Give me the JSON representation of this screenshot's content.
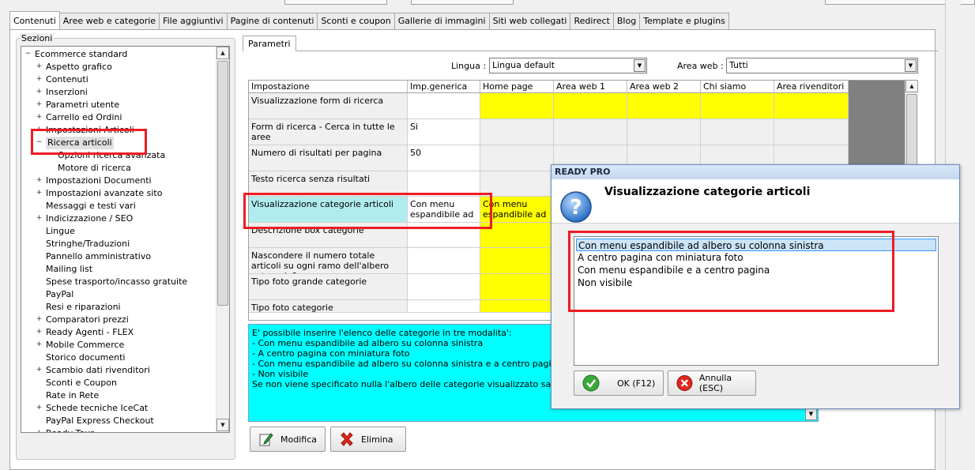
{
  "main_tabs": [
    "Contenuti",
    "Aree web e categorie",
    "File aggiuntivi",
    "Pagine di contenuti",
    "Sconti e coupon",
    "Gallerie di immagini",
    "Siti web collegati",
    "Redirect",
    "Blog",
    "Template e plugins"
  ],
  "sections_title": "Sezioni",
  "tree": {
    "root": "Ecommerce standard",
    "items": [
      {
        "label": "Aspetto grafico",
        "exp": "+"
      },
      {
        "label": "Contenuti",
        "exp": "+"
      },
      {
        "label": "Inserzioni",
        "exp": "+"
      },
      {
        "label": "Parametri utente",
        "exp": "+"
      },
      {
        "label": "Carrello ed Ordini",
        "exp": "+"
      },
      {
        "label": "Impostazioni Articoli",
        "exp": "+"
      },
      {
        "label": "Ricerca articoli",
        "exp": "-"
      },
      {
        "label": "Opzioni ricerca avanzata",
        "exp": "",
        "child": true
      },
      {
        "label": "Motore di ricerca",
        "exp": "",
        "child": true
      },
      {
        "label": "Impostazioni Documenti",
        "exp": "+"
      },
      {
        "label": "Impostazioni avanzate sito",
        "exp": "+"
      },
      {
        "label": "Messaggi e testi vari",
        "exp": ""
      },
      {
        "label": "Indicizzazione / SEO",
        "exp": "+"
      },
      {
        "label": "Lingue",
        "exp": ""
      },
      {
        "label": "Stringhe/Traduzioni",
        "exp": ""
      },
      {
        "label": "Pannello amministrativo",
        "exp": ""
      },
      {
        "label": "Mailing list",
        "exp": ""
      },
      {
        "label": "Spese trasporto/incasso gratuite",
        "exp": ""
      },
      {
        "label": "PayPal",
        "exp": ""
      },
      {
        "label": "Resi e riparazioni",
        "exp": ""
      },
      {
        "label": "Comparatori prezzi",
        "exp": "+"
      },
      {
        "label": "Ready Agenti - FLEX",
        "exp": "+"
      },
      {
        "label": "Mobile Commerce",
        "exp": "+"
      },
      {
        "label": "Storico documenti",
        "exp": ""
      },
      {
        "label": "Scambio dati rivenditori",
        "exp": "+"
      },
      {
        "label": "Sconti e Coupon",
        "exp": ""
      },
      {
        "label": "Rate in Rete",
        "exp": ""
      },
      {
        "label": "Schede tecniche IceCat",
        "exp": "+"
      },
      {
        "label": "PayPal Express Checkout",
        "exp": ""
      },
      {
        "label": "Ready Tour",
        "exp": "+"
      }
    ]
  },
  "params_tab": "Parametri",
  "filters": {
    "lingua_label": "Lingua :",
    "lingua_value": "Lingua default",
    "area_label": "Area web :",
    "area_value": "Tutti"
  },
  "grid": {
    "headers": [
      "Impostazione",
      "Imp.generica",
      "Home page",
      "Area web 1",
      "Area web 2",
      "Chi siamo",
      "Area rivenditori"
    ],
    "rows": [
      {
        "name": "Visualizzazione form di ricerca",
        "generic": "",
        "home": ""
      },
      {
        "name": "Form di ricerca - Cerca in tutte le aree",
        "generic": "Si",
        "home": ""
      },
      {
        "name": "Numero di risultati per pagina",
        "generic": "50",
        "home": ""
      },
      {
        "name": "Testo ricerca senza risultati",
        "generic": "",
        "home": ""
      },
      {
        "name": "Visualizzazione categorie articoli",
        "generic": "Con menu espandibile ad ...",
        "home": "Con menu espandibile ad ..."
      },
      {
        "name": "Descrizione box categorie",
        "generic": "",
        "home": ""
      },
      {
        "name": "Nascondere il numero totale articoli su ogni ramo dell'albero categorie?",
        "generic": "",
        "home": ""
      },
      {
        "name": "Tipo foto grande categorie",
        "generic": "",
        "home": ""
      },
      {
        "name": "Tipo foto categorie",
        "generic": "",
        "home": ""
      }
    ]
  },
  "description": [
    "E' possibile inserire l'elenco delle categorie in tre modalita':",
    "- Con menu espandibile ad albero su colonna sinistra",
    "- A centro pagina con miniatura foto",
    "- Con menu espandibile ad albero su colonna sinistra e a centro pagina con miniatura foto",
    "- Non visibile",
    "Se non viene specificato nulla l'albero delle categorie visualizzato sara' quello a sinistra"
  ],
  "buttons": {
    "modify": "Modifica",
    "delete": "Elimina"
  },
  "dialog": {
    "title": "READY PRO",
    "heading": "Visualizzazione categorie articoli",
    "options": [
      "Con menu espandibile ad albero su colonna sinistra",
      "A centro pagina con miniatura foto",
      "Con menu espandibile e a centro pagina",
      "Non visibile"
    ],
    "ok": "OK (F12)",
    "cancel": "Annulla (ESC)"
  },
  "colors": {
    "highlight_red": "#ee1c24",
    "yellow": "#ffff00",
    "cyan": "#00ffff",
    "selection": "#cce4f7"
  }
}
